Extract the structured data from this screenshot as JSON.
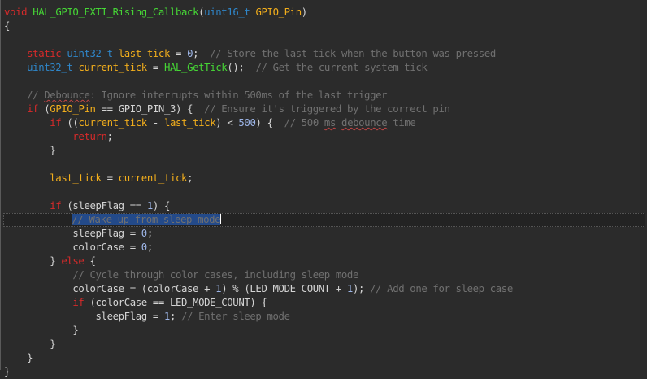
{
  "lines": [
    {
      "segments": [
        {
          "t": "void",
          "c": "kw"
        },
        {
          "t": " "
        },
        {
          "t": "HAL_GPIO_EXTI_Rising_Callback",
          "c": "fn"
        },
        {
          "t": "("
        },
        {
          "t": "uint16_t",
          "c": "type"
        },
        {
          "t": " "
        },
        {
          "t": "GPIO_Pin",
          "c": "var"
        },
        {
          "t": ")"
        }
      ]
    },
    {
      "segments": [
        {
          "t": "{"
        }
      ]
    },
    {
      "segments": []
    },
    {
      "segments": [
        {
          "t": "    "
        },
        {
          "t": "static",
          "c": "kw"
        },
        {
          "t": " "
        },
        {
          "t": "uint32_t",
          "c": "type"
        },
        {
          "t": " "
        },
        {
          "t": "last_tick",
          "c": "var"
        },
        {
          "t": " = "
        },
        {
          "t": "0",
          "c": "num"
        },
        {
          "t": ";  "
        },
        {
          "t": "// Store the last tick when the button was pressed",
          "c": "comment"
        }
      ]
    },
    {
      "segments": [
        {
          "t": "    "
        },
        {
          "t": "uint32_t",
          "c": "type"
        },
        {
          "t": " "
        },
        {
          "t": "current_tick",
          "c": "var"
        },
        {
          "t": " = "
        },
        {
          "t": "HAL_GetTick",
          "c": "fn"
        },
        {
          "t": "();  "
        },
        {
          "t": "// Get the current system tick",
          "c": "comment"
        }
      ]
    },
    {
      "segments": []
    },
    {
      "segments": [
        {
          "t": "    "
        },
        {
          "t": "// ",
          "c": "comment"
        },
        {
          "t": "Debounce",
          "c": "comment",
          "sq": true
        },
        {
          "t": ": Ignore interrupts within 500ms of the last trigger",
          "c": "comment"
        }
      ]
    },
    {
      "segments": [
        {
          "t": "    "
        },
        {
          "t": "if",
          "c": "kw"
        },
        {
          "t": " ("
        },
        {
          "t": "GPIO_Pin",
          "c": "var"
        },
        {
          "t": " == GPIO_PIN_3) {  "
        },
        {
          "t": "// Ensure it's triggered by the correct pin",
          "c": "comment"
        }
      ]
    },
    {
      "segments": [
        {
          "t": "        "
        },
        {
          "t": "if",
          "c": "kw"
        },
        {
          "t": " (("
        },
        {
          "t": "current_tick",
          "c": "var"
        },
        {
          "t": " - "
        },
        {
          "t": "last_tick",
          "c": "var"
        },
        {
          "t": ") < "
        },
        {
          "t": "500",
          "c": "num"
        },
        {
          "t": ") {  "
        },
        {
          "t": "// 500 ",
          "c": "comment"
        },
        {
          "t": "ms",
          "c": "comment",
          "sq": true
        },
        {
          "t": " ",
          "c": "comment"
        },
        {
          "t": "debounce",
          "c": "comment",
          "sq": true
        },
        {
          "t": " time",
          "c": "comment"
        }
      ]
    },
    {
      "segments": [
        {
          "t": "            "
        },
        {
          "t": "return",
          "c": "kw"
        },
        {
          "t": ";"
        }
      ]
    },
    {
      "segments": [
        {
          "t": "        }"
        }
      ]
    },
    {
      "segments": []
    },
    {
      "segments": [
        {
          "t": "        "
        },
        {
          "t": "last_tick",
          "c": "var"
        },
        {
          "t": " = "
        },
        {
          "t": "current_tick",
          "c": "var"
        },
        {
          "t": ";"
        }
      ]
    },
    {
      "segments": []
    },
    {
      "segments": [
        {
          "t": "        "
        },
        {
          "t": "if",
          "c": "kw"
        },
        {
          "t": " (sleepFlag == "
        },
        {
          "t": "1",
          "c": "num"
        },
        {
          "t": ") {"
        }
      ]
    },
    {
      "current": true,
      "segments": [
        {
          "t": "            "
        },
        {
          "t": "// Wake up from sleep mode",
          "c": "comment",
          "sel": true
        },
        {
          "caret": true
        }
      ]
    },
    {
      "segments": [
        {
          "t": "            sleepFlag = "
        },
        {
          "t": "0",
          "c": "num"
        },
        {
          "t": ";"
        }
      ]
    },
    {
      "segments": [
        {
          "t": "            colorCase = "
        },
        {
          "t": "0",
          "c": "num"
        },
        {
          "t": ";"
        }
      ]
    },
    {
      "segments": [
        {
          "t": "        } "
        },
        {
          "t": "else",
          "c": "kw"
        },
        {
          "t": " {"
        }
      ]
    },
    {
      "segments": [
        {
          "t": "            "
        },
        {
          "t": "// Cycle through color cases, including sleep mode",
          "c": "comment"
        }
      ]
    },
    {
      "segments": [
        {
          "t": "            colorCase = (colorCase + "
        },
        {
          "t": "1",
          "c": "num"
        },
        {
          "t": ") % (LED_MODE_COUNT + "
        },
        {
          "t": "1",
          "c": "num"
        },
        {
          "t": "); "
        },
        {
          "t": "// Add one for sleep case",
          "c": "comment"
        }
      ]
    },
    {
      "segments": [
        {
          "t": "            "
        },
        {
          "t": "if",
          "c": "kw"
        },
        {
          "t": " (colorCase == LED_MODE_COUNT) {"
        }
      ]
    },
    {
      "segments": [
        {
          "t": "                sleepFlag = "
        },
        {
          "t": "1",
          "c": "num"
        },
        {
          "t": "; "
        },
        {
          "t": "// Enter sleep mode",
          "c": "comment"
        }
      ]
    },
    {
      "segments": [
        {
          "t": "            }"
        }
      ]
    },
    {
      "segments": [
        {
          "t": "        }"
        }
      ]
    },
    {
      "segments": [
        {
          "t": "    }"
        }
      ]
    },
    {
      "segments": [
        {
          "t": "}"
        }
      ]
    }
  ],
  "colors": {
    "background": "#2b2b2b",
    "keyword": "#d62b2b",
    "type": "#2f86c9",
    "function": "#46d636",
    "variable": "#f2ae1c",
    "comment": "#707070",
    "number": "#9db5e7",
    "selection": "#234a8a"
  }
}
